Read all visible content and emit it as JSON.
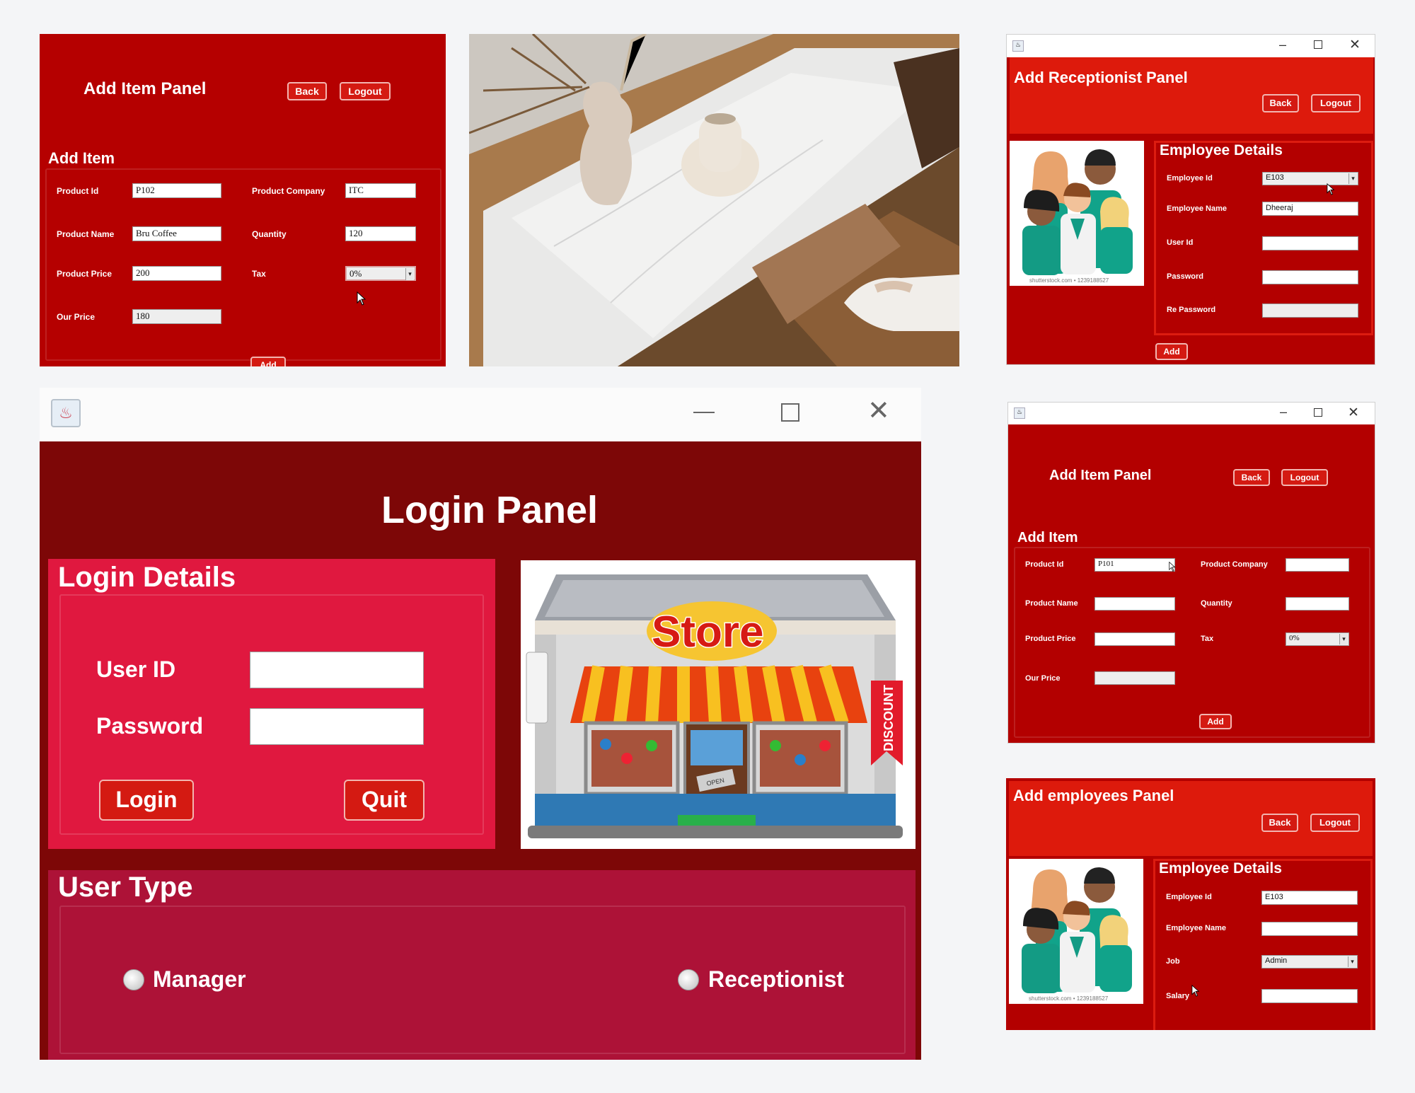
{
  "add_item_top_left": {
    "panel_title": "Add Item Panel",
    "back_label": "Back",
    "logout_label": "Logout",
    "section_title": "Add Item",
    "product_id_label": "Product Id",
    "product_id_value": "P102",
    "product_company_label": "Product Company",
    "product_company_value": "ITC",
    "product_name_label": "Product Name",
    "product_name_value": "Bru Coffee",
    "quantity_label": "Quantity",
    "quantity_value": "120",
    "product_price_label": "Product Price",
    "product_price_value": "200",
    "tax_label": "Tax",
    "tax_value": "0%",
    "our_price_label": "Our Price",
    "our_price_value": "180",
    "add_label": "Add"
  },
  "add_receptionist": {
    "panel_title": "Add Receptionist Panel",
    "back_label": "Back",
    "logout_label": "Logout",
    "section_title": "Employee Details",
    "employee_id_label": "Employee Id",
    "employee_id_value": "E103",
    "employee_name_label": "Employee Name",
    "employee_name_value": "Dheeraj",
    "user_id_label": "User Id",
    "user_id_value": "",
    "password_label": "Password",
    "password_value": "",
    "re_password_label": "Re Password",
    "re_password_value": "",
    "add_label": "Add",
    "image_caption": "shutterstock.com • 1239188527"
  },
  "login": {
    "panel_title": "Login Panel",
    "details_title": "Login Details",
    "user_id_label": "User ID",
    "user_id_value": "",
    "password_label": "Password",
    "password_value": "",
    "login_label": "Login",
    "quit_label": "Quit",
    "store_sign": "Store",
    "discount_banner": "DISCOUNT",
    "open_sign": "OPEN",
    "user_type_title": "User Type",
    "manager_label": "Manager",
    "receptionist_label": "Receptionist"
  },
  "add_item_right": {
    "panel_title": "Add Item Panel",
    "back_label": "Back",
    "logout_label": "Logout",
    "section_title": "Add Item",
    "product_id_label": "Product Id",
    "product_id_value": "P101",
    "product_company_label": "Product Company",
    "product_company_value": "",
    "product_name_label": "Product Name",
    "product_name_value": "",
    "quantity_label": "Quantity",
    "quantity_value": "",
    "product_price_label": "Product Price",
    "product_price_value": "",
    "tax_label": "Tax",
    "tax_value": "0%",
    "our_price_label": "Our Price",
    "our_price_value": "",
    "add_label": "Add"
  },
  "add_employees": {
    "panel_title": "Add employees Panel",
    "back_label": "Back",
    "logout_label": "Logout",
    "section_title": "Employee Details",
    "employee_id_label": "Employee Id",
    "employee_id_value": "E103",
    "employee_name_label": "Employee Name",
    "employee_name_value": "",
    "job_label": "Job",
    "job_value": "Admin",
    "salary_label": "Salary",
    "salary_value": "",
    "image_caption": "shutterstock.com • 1239188527"
  },
  "icons": [
    "java-app-icon",
    "minimize-icon",
    "maximize-icon",
    "close-icon",
    "dropdown-arrow-icon",
    "mouse-cursor-icon",
    "radio-button-icon"
  ],
  "colors": {
    "panel_red": "#b30000",
    "login_pink": "#e0183f",
    "user_type_crimson": "#ad1237",
    "dark_header": "#7d0707"
  }
}
